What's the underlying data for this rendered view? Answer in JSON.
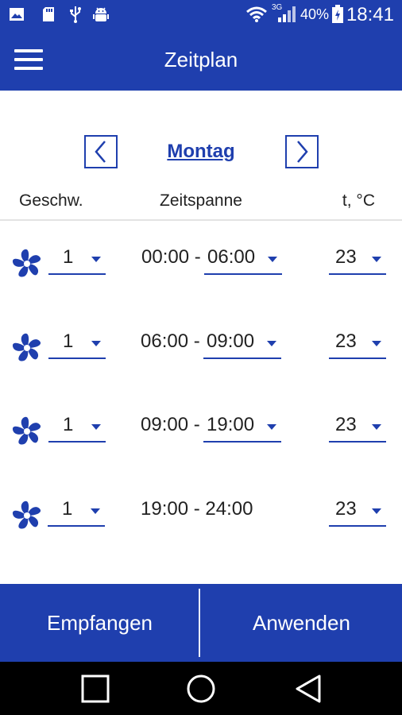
{
  "status_bar": {
    "network_label": "3G",
    "battery": "40%",
    "time": "18:41"
  },
  "app_bar": {
    "title": "Zeitplan",
    "menu_icon": "hamburger-menu-icon"
  },
  "day_selector": {
    "day": "Montag",
    "prev_icon": "chevron-left-icon",
    "next_icon": "chevron-right-icon"
  },
  "columns": {
    "speed": "Geschw.",
    "span": "Zeitspanne",
    "temp": "t, °C"
  },
  "rows": [
    {
      "speed": "1",
      "start": "00:00 - ",
      "end": "06:00",
      "temp": "23"
    },
    {
      "speed": "1",
      "start": "06:00 - ",
      "end": "09:00",
      "temp": "23"
    },
    {
      "speed": "1",
      "start": "09:00 - ",
      "end": "19:00",
      "temp": "23"
    },
    {
      "speed": "1",
      "span": "19:00 - 24:00",
      "temp": "23"
    }
  ],
  "buttons": {
    "receive": "Empfangen",
    "apply": "Anwenden"
  },
  "colors": {
    "primary": "#1f3fae",
    "background": "#ffffff",
    "nav_bar": "#000000"
  }
}
